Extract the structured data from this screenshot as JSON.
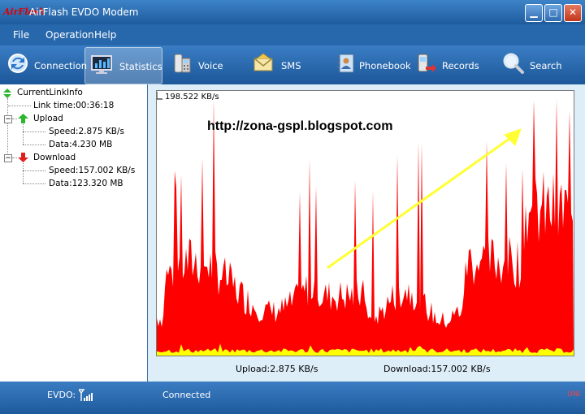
{
  "window": {
    "logo_text": "AirFlash",
    "title": "AirFlash EVDO Modem"
  },
  "menu": [
    "File",
    "Operation",
    "Help"
  ],
  "toolbar": [
    {
      "label": "Connection",
      "icon": "connection-icon"
    },
    {
      "label": "Statistics",
      "icon": "statistics-icon",
      "active": true
    },
    {
      "label": "Voice",
      "icon": "phone-icon"
    },
    {
      "label": "SMS",
      "icon": "envelope-icon"
    },
    {
      "label": "Phonebook",
      "icon": "phonebook-icon"
    },
    {
      "label": "Records",
      "icon": "records-icon"
    },
    {
      "label": "Search",
      "icon": "magnifier-icon"
    }
  ],
  "tree": {
    "root": "CurrentLinkInfo",
    "link_time": "Link time:00:36:18",
    "upload": {
      "label": "Upload",
      "speed": "Speed:2.875 KB/s",
      "data": "Data:4.230 MB"
    },
    "download": {
      "label": "Download",
      "speed": "Speed:157.002 KB/s",
      "data": "Data:123.320 MB"
    }
  },
  "graph": {
    "max_label": "198.522 KB/s",
    "overlay_url": "http://zona-gspl.blogspot.com",
    "upload_label": "Upload:2.875 KB/s",
    "download_label": "Download:157.002 KB/s",
    "download_color": "#ff0000",
    "upload_color": "#ffff00",
    "arrow_color": "#ffff33"
  },
  "status": {
    "evdo_label": "EVDO:",
    "connection": "Connected",
    "corner": "UNI"
  }
}
